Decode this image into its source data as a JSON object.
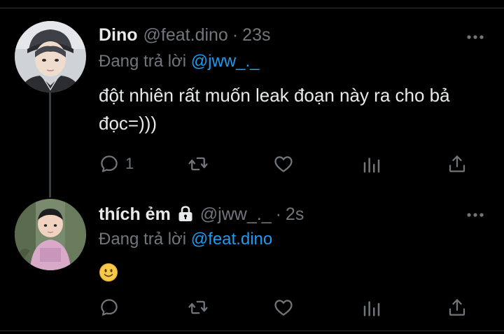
{
  "tweets": [
    {
      "name": "Dino",
      "handle": "@feat.dino",
      "separator": "·",
      "time": "23s",
      "replying_prefix": "Đang trả lời",
      "replying_to": "@jww_._",
      "text": "đột nhiên rất muốn leak đoạn này ra cho bả đọc=)))",
      "reply_count": "1",
      "protected": false
    },
    {
      "name": "thích ẻm",
      "handle": "@jww_._",
      "separator": "·",
      "time": "2s",
      "replying_prefix": "Đang trả lời",
      "replying_to": "@feat.dino",
      "text": "slightly-smiling-face-emoji",
      "reply_count": "",
      "protected": true
    }
  ],
  "colors": {
    "background": "#000000",
    "text": "#e7e9ea",
    "muted": "#71767b",
    "accent": "#1d9bf0",
    "divider": "#2f3336"
  },
  "icons": [
    "reply-icon",
    "retweet-icon",
    "like-icon",
    "views-icon",
    "share-icon",
    "more-icon",
    "lock-icon"
  ]
}
